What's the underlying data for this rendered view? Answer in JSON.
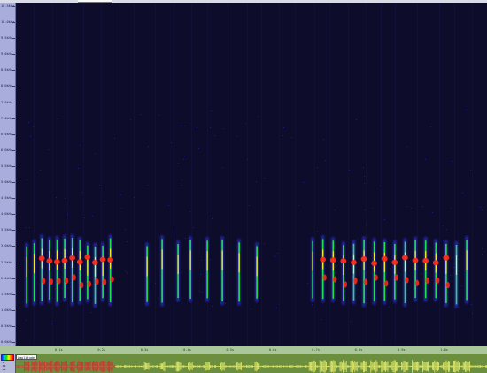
{
  "frequency_axis": {
    "labels": [
      "10.5kHz",
      "10.0kHz",
      "9.5kHz",
      "9.0kHz",
      "8.5kHz",
      "8.0kHz",
      "7.5kHz",
      "7.0kHz",
      "6.5kHz",
      "6.0kHz",
      "5.5kHz",
      "5.0kHz",
      "4.5kHz",
      "4.0kHz",
      "3.5kHz",
      "3.0kHz",
      "2.5kHz",
      "2.0kHz",
      "1.5kHz",
      "1.0kHz",
      "0.5kHz",
      "0.0kHz"
    ]
  },
  "time_axis": {
    "labels": [
      "0.1s",
      "0.2s",
      "0.3s",
      "0.4s",
      "0.5s",
      "0.6s",
      "0.7s",
      "0.8s",
      "0.9s",
      "1.0s"
    ]
  },
  "waveform_panel": {
    "mode_label": "Amplitude",
    "amplitude_labels": [
      "-6",
      "-12",
      "-18"
    ],
    "colors": {
      "background": "#6b8e3f",
      "selected": "#d23030",
      "wave": "#e8f06a"
    }
  },
  "spectrogram": {
    "colors": {
      "background": "#0d0c2b",
      "low": "#2f2fd0",
      "mid": "#22e04a",
      "high": "#ffee22",
      "peak": "#ff2a1a"
    }
  }
}
